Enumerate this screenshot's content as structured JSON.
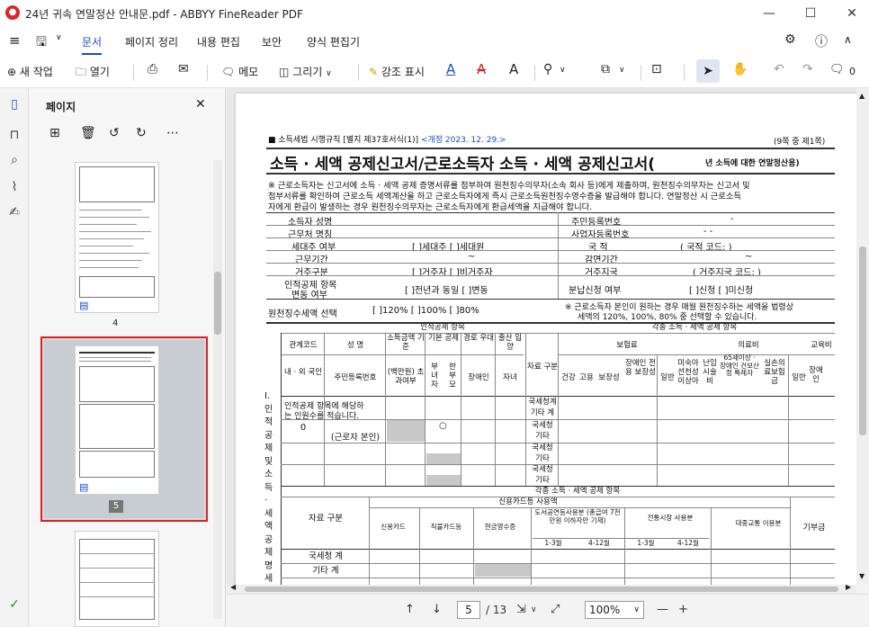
{
  "window": {
    "title": "24년 귀속 연말정산 안내문.pdf - ABBYY FineReader PDF",
    "controls": [
      "—",
      "☐",
      "✕"
    ]
  },
  "menu": {
    "items": [
      "문서",
      "페이지 정리",
      "내용 편집",
      "보안",
      "양식 편집기"
    ],
    "active": "문서"
  },
  "toolbar": {
    "new_task": "새 작업",
    "open": "열기",
    "memo": "메모",
    "draw": "그리기",
    "highlight": "강조 표시",
    "comment_count": "0"
  },
  "pages_panel": {
    "title": "페이지",
    "thumbs": [
      {
        "label": "4",
        "selected": false
      },
      {
        "label": "5",
        "selected": true
      }
    ]
  },
  "doc": {
    "form_ref": "■ 소득세법 시행규칙 [별지 제37호서식(1)]",
    "revised": "<개정 2023. 12. 29.>",
    "page_count": "(9쪽 중 제1쪽)",
    "heading": "소득 · 세액 공제신고서/근로소득자 소득 · 세액 공제신고서(",
    "heading_suffix": "년 소득에 대한 연말정산용)",
    "notice_l1": "※ 근로소득자는 신고서에 소득 · 세액 공제 증명서류를 첨부하여 원천징수의무자(소속 회사 등)에게 제출하며, 원천징수의무자는 신고서 및",
    "notice_l2": "첨부서류를 확인하여 근로소득 세액계산을 하고 근로소득자에게 즉시 근로소득원천징수영수증을 발급해야 합니다. 연말정산 시 근로소득",
    "notice_l3": "자에게 환급이 발생하는 경우 원천징수의무자는 근로소득자에게 환급세액을 지급해야 합니다.",
    "rows_left": [
      "소득자 성명",
      "근무처 명칭",
      "세대주 여부",
      "근무기간",
      "거주구분",
      "인적공제 항목",
      "변동 여부"
    ],
    "rows_left_values": [
      "",
      "",
      "[    ]세대주  [    ]세대원",
      "~",
      "[    ]거주자  [    ]비거주자",
      "[    ]전년과 동일  [    ]변동"
    ],
    "rows_right": [
      "주민등록번호",
      "사업자등록번호",
      "국  적",
      "감면기간",
      "거주지국",
      "분납신청 여부"
    ],
    "rows_right_values": [
      "-",
      "-       -",
      "( 국적 코드:         )",
      "~",
      "( 거주지국 코드:          )",
      "[    ]신청  [    ]미신청"
    ],
    "withhold_label": "원천징수세액 선택",
    "withhold_options": "[    ]120%  [    ]100%  [    ]80%",
    "withhold_note_l1": "※ 근로소득자 본인이 원하는 경우 매월 원천징수하는 세액을 법령상",
    "withhold_note_l2": "세액의 120%, 100%, 80% 중 선택할 수 있습니다.",
    "personal_header": "인적공제 항목",
    "various_header": "각종 소득 · 세액 공제 항목",
    "col_relcode": "관계코드",
    "col_name": "성  명",
    "col_income": "소득금액 기준",
    "col_basic": "기본 공제",
    "col_elder": "경로 우대",
    "col_birth": "출산 입양",
    "col_source": "자료 구분",
    "col_insurance": "보험료",
    "col_medical": "의료비",
    "col_edu": "교육비",
    "col_domestic": "내 · 외 국인",
    "col_rrn": "주민등록번호",
    "col_over": "(백만원) 초과여부",
    "col_single": "부 녀 자",
    "col_oneparent": "한 부 모",
    "col_disabled": "장애인",
    "col_child": "자녀",
    "ins_cols": [
      "건강",
      "고용",
      "보장성",
      "장애인 전용 보장성"
    ],
    "med_cols": [
      "일반",
      "미숙아 선천성 이상아",
      "난임 시술 비",
      "65세이상 · 장애인 건보산정 특례자",
      "실손의 료보험 금"
    ],
    "edu_cols": [
      "일반",
      "장애 인"
    ],
    "side_label": "I. 인적공제 및 소득 · 세액공제 명세",
    "rows_mid": [
      "국세청계",
      "기타 계",
      "국세청",
      "기타",
      "국세청",
      "기타",
      "국세청",
      "기타"
    ],
    "target_text_l1": "인적공제 항목에 해당하",
    "target_text_l2": "는 인원수를 적습니다.",
    "self_code": "0",
    "self_label": "(근로자 본인)",
    "card_header": "신용카드등 사용액",
    "card_cols": [
      "신용카드",
      "직불카드등",
      "현금영수증",
      "도서공연등사용분 (총급여 7천만원 이하자만 기재)",
      "전통시장 사용분",
      "대중교통 이용분",
      "기부금"
    ],
    "card_sub": [
      "1-3월",
      "4-12월",
      "1-3월",
      "4-12월"
    ],
    "card_rows": [
      "국세청 계",
      "기타 계"
    ]
  },
  "status": {
    "current_page": "5",
    "total_pages": "/ 13",
    "zoom": "100%"
  }
}
